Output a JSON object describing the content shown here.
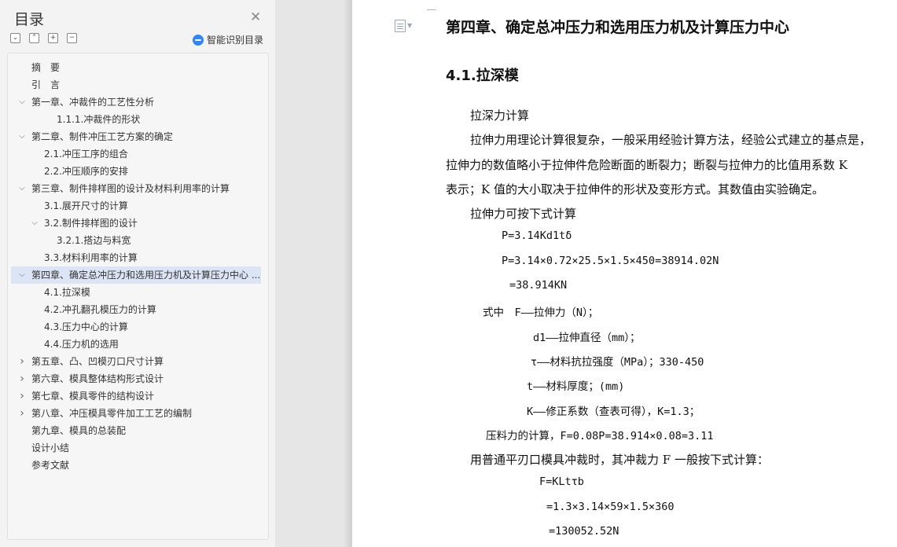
{
  "toc": {
    "title": "目录",
    "close_icon": "close-icon",
    "tools": [
      "collapse-all-icon",
      "expand-all-icon",
      "add-heading-icon",
      "remove-heading-icon"
    ],
    "smart_label": "智能识别目录",
    "items": [
      {
        "label": "摘　要",
        "level": 1,
        "caret": ""
      },
      {
        "label": "引　言",
        "level": 1,
        "caret": ""
      },
      {
        "label": "第一章、冲裁件的工艺性分析",
        "level": 1,
        "caret": "v"
      },
      {
        "label": "1.1.1.冲裁件的形状",
        "level": 3,
        "caret": ""
      },
      {
        "label": "第二章、制件冲压工艺方案的确定",
        "level": 1,
        "caret": "v"
      },
      {
        "label": "2.1.冲压工序的组合",
        "level": 2,
        "caret": ""
      },
      {
        "label": "2.2.冲压顺序的安排",
        "level": 2,
        "caret": ""
      },
      {
        "label": "第三章、制件排样图的设计及材料利用率的计算",
        "level": 1,
        "caret": "v"
      },
      {
        "label": "3.1.展开尺寸的计算",
        "level": 2,
        "caret": ""
      },
      {
        "label": "3.2.制件排样图的设计",
        "level": 2,
        "caret": "v"
      },
      {
        "label": "3.2.1.搭边与料宽",
        "level": 3,
        "caret": ""
      },
      {
        "label": "3.3.材料利用率的计算",
        "level": 2,
        "caret": ""
      },
      {
        "label": "第四章、确定总冲压力和选用压力机及计算压力中心 ...",
        "level": 1,
        "caret": "v",
        "active": true
      },
      {
        "label": "4.1.拉深模",
        "level": 2,
        "caret": ""
      },
      {
        "label": "4.2.冲孔翻孔模压力的计算",
        "level": 2,
        "caret": ""
      },
      {
        "label": "4.3.压力中心的计算",
        "level": 2,
        "caret": ""
      },
      {
        "label": "4.4.压力机的选用",
        "level": 2,
        "caret": ""
      },
      {
        "label": "第五章、凸、凹模刃口尺寸计算",
        "level": 1,
        "caret": ">"
      },
      {
        "label": "第六章、模具整体结构形式设计",
        "level": 1,
        "caret": ">"
      },
      {
        "label": "第七章、模具零件的结构设计",
        "level": 1,
        "caret": ">"
      },
      {
        "label": "第八章、冲压模具零件加工工艺的编制",
        "level": 1,
        "caret": ">"
      },
      {
        "label": "第九章、模具的总装配",
        "level": 1,
        "caret": ""
      },
      {
        "label": "设计小结",
        "level": 1,
        "caret": ""
      },
      {
        "label": "参考文献",
        "level": 1,
        "caret": ""
      }
    ]
  },
  "doc": {
    "chapter_title": "第四章、确定总冲压力和选用压力机及计算压力中心",
    "section_title": "4.1.拉深模",
    "lines": [
      {
        "text": "拉深力计算",
        "style": "body"
      },
      {
        "text": "拉伸力用理论计算很复杂，一般采用经验计算方法，经验公式建立的基点是，",
        "style": "body"
      },
      {
        "text": "拉伸力的数值略小于拉伸件危险断面的断裂力；断裂与拉伸力的比值用系数 K",
        "style": "body"
      },
      {
        "text": "表示；K 值的大小取决于拉伸件的形状及变形方式。其数值由实验确定。",
        "style": "body"
      },
      {
        "text": "拉伸力可按下式计算",
        "style": "body"
      },
      {
        "text": "P=3.14Kd1tδ",
        "style": "mono"
      },
      {
        "text": "P=3.14×0.72×25.5×1.5×450=38914.02N",
        "style": "mono"
      },
      {
        "text": "=38.914KN",
        "style": "mono"
      },
      {
        "text": "式中　F——拉伸力（N）；",
        "style": "mono"
      },
      {
        "text": "d1——拉伸直径（mm）；",
        "style": "mono"
      },
      {
        "text": "τ——材料抗拉强度（MPa）；330-450",
        "style": "mono"
      },
      {
        "text": "t——材料厚度；(mm)",
        "style": "mono"
      },
      {
        "text": "K——修正系数（查表可得），K=1.3；",
        "style": "mono"
      },
      {
        "text": "压料力的计算，F=0.08P=38.914×0.08=3.11",
        "style": "mono"
      },
      {
        "text": "用普通平刃口模具冲裁时，其冲裁力 F 一般按下式计算：",
        "style": "body"
      },
      {
        "text": "F=KLtτb",
        "style": "mono"
      },
      {
        "text": "=1.3×3.14×59×1.5×360",
        "style": "mono"
      },
      {
        "text": "=130052.52N",
        "style": "mono"
      }
    ]
  }
}
